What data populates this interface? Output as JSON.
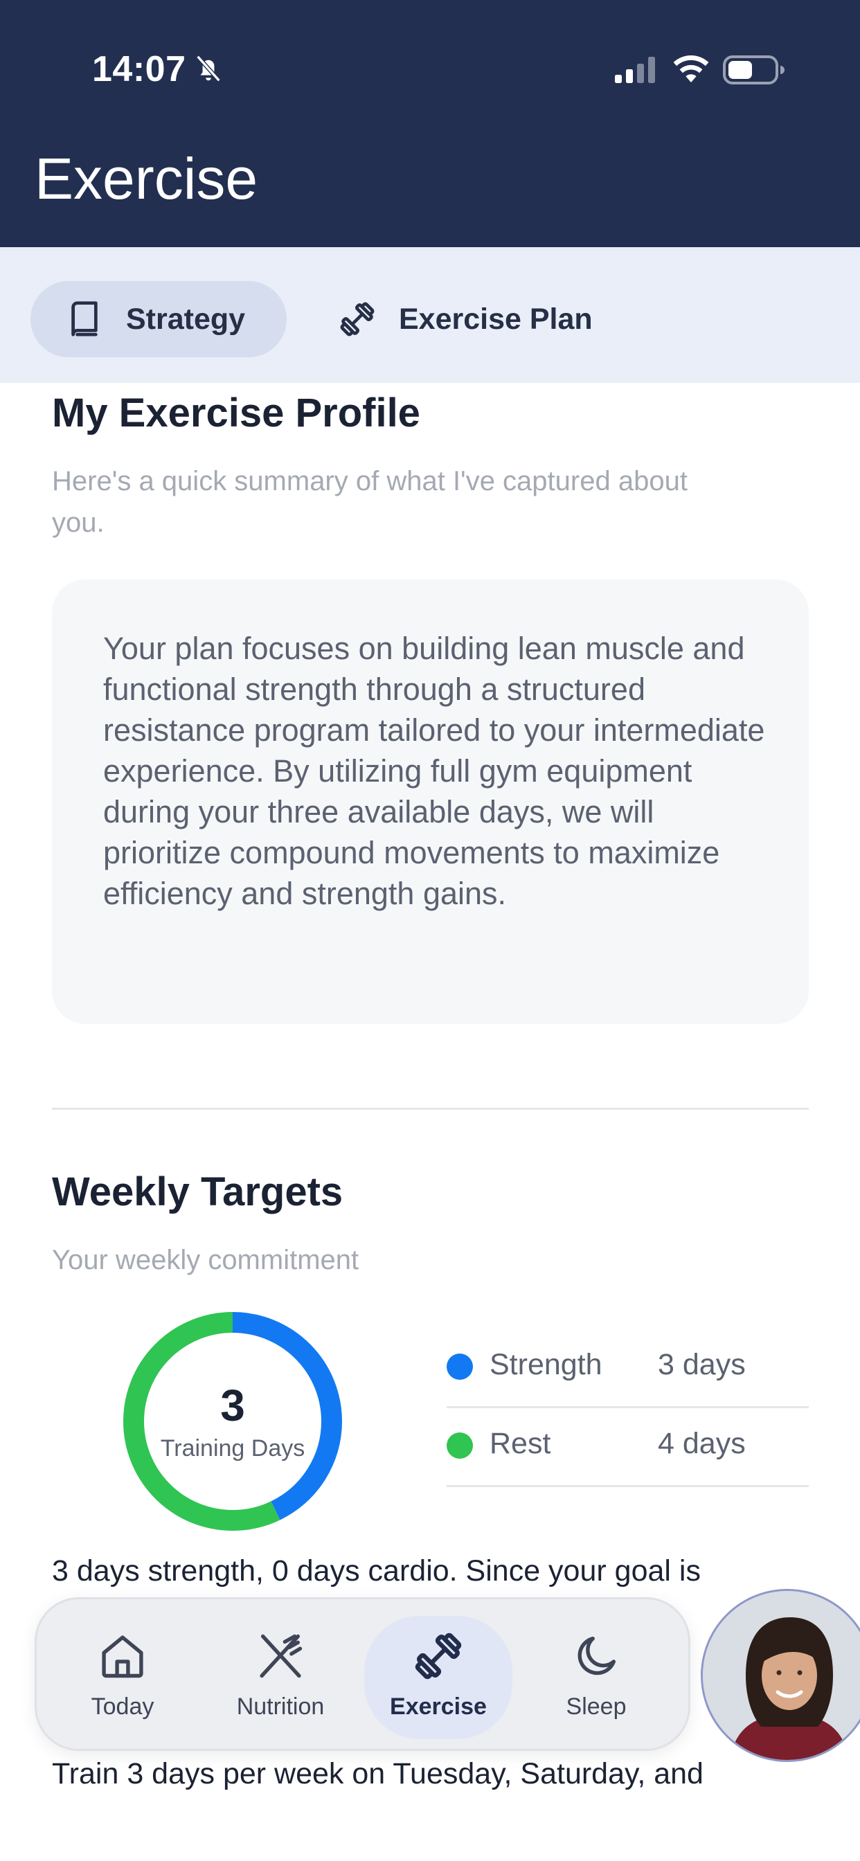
{
  "status_bar": {
    "time": "14:07"
  },
  "header": {
    "title": "Exercise"
  },
  "tabs": [
    {
      "label": "Strategy",
      "icon": "book-icon",
      "active": true
    },
    {
      "label": "Exercise Plan",
      "icon": "dumbbell-icon",
      "active": false
    }
  ],
  "profile": {
    "title": "My Exercise Profile",
    "subtitle_line1": "Here's a quick summary of what I've captured about",
    "subtitle_line2": "you.",
    "summary": "Your plan focuses on building lean muscle and functional strength through a structured resistance program tailored to your intermediate experience. By utilizing full gym equipment during your three available days, we will prioritize compound movements to maximize efficiency and strength gains."
  },
  "weekly_targets": {
    "title": "Weekly Targets",
    "subtitle": "Your weekly commitment",
    "donut": {
      "value": "3",
      "label": "Training Days",
      "segments": [
        {
          "name": "Strength",
          "days": 3,
          "color": "#1279f2"
        },
        {
          "name": "Rest",
          "days": 4,
          "color": "#30c452"
        }
      ]
    },
    "legend": [
      {
        "name": "Strength",
        "value": "3 days",
        "color": "#1279f2"
      },
      {
        "name": "Rest",
        "value": "4 days",
        "color": "#30c452"
      }
    ],
    "description_line1": "3 days strength, 0 days cardio. Since your goal is",
    "description_line_last": "Train 3 days per week on Tuesday, Saturday, and"
  },
  "bottom_nav": [
    {
      "label": "Today",
      "icon": "home-icon",
      "active": false
    },
    {
      "label": "Nutrition",
      "icon": "fork-knife-icon",
      "active": false
    },
    {
      "label": "Exercise",
      "icon": "dumbbell-icon",
      "active": true
    },
    {
      "label": "Sleep",
      "icon": "moon-icon",
      "active": false
    }
  ],
  "colors": {
    "header_bg": "#232f50",
    "tabbar_bg": "#e9eef9",
    "active_tab_bg": "#d5ddef",
    "strength": "#1279f2",
    "rest": "#30c452"
  }
}
